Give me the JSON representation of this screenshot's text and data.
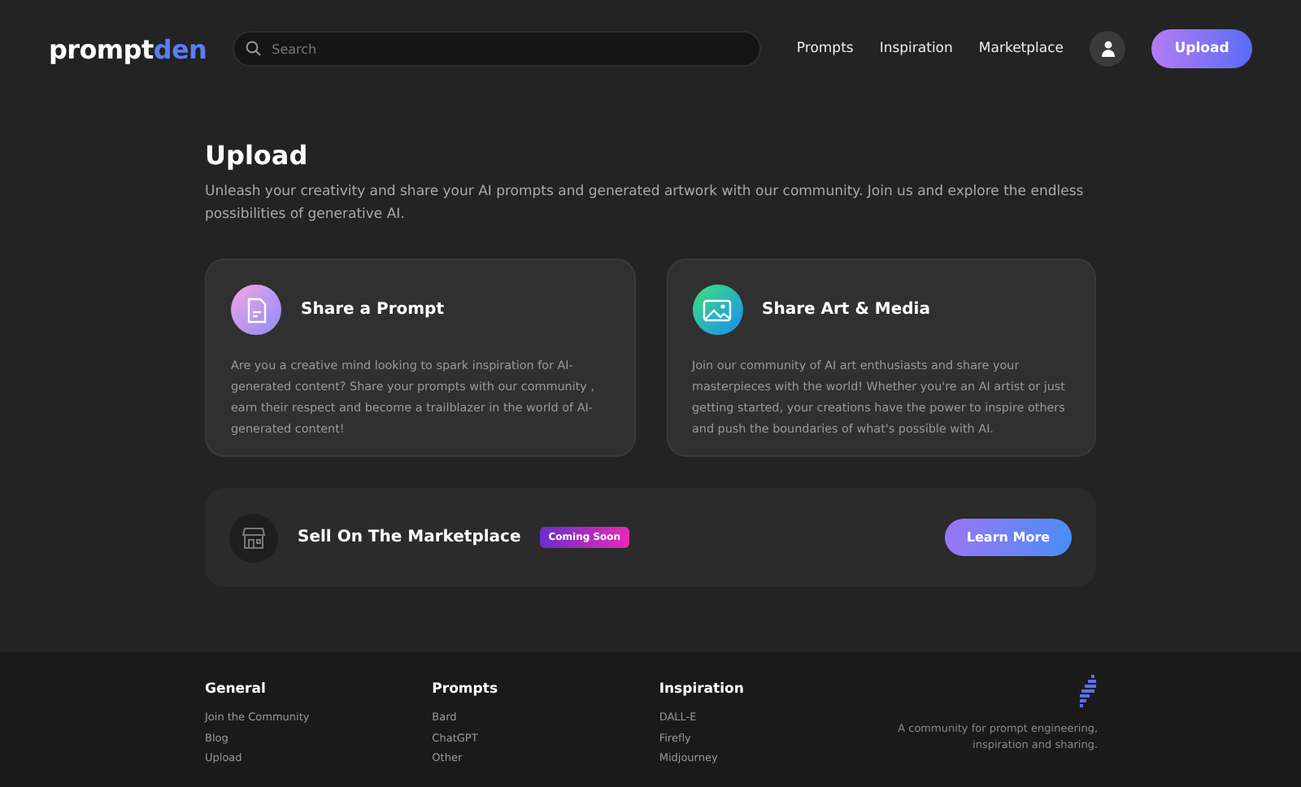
{
  "logo": {
    "first": "prompt",
    "second": "den"
  },
  "search": {
    "placeholder": "Search"
  },
  "nav": [
    "Prompts",
    "Inspiration",
    "Marketplace"
  ],
  "upload_button": "Upload",
  "page": {
    "title": "Upload",
    "intro": "Unleash your creativity and share your AI prompts and generated artwork with our community. Join us and explore the endless possibilities of generative AI."
  },
  "cards": [
    {
      "kind": "prompt",
      "title": "Share a Prompt",
      "text": "Are you a creative mind looking to spark inspiration for AI-generated content? Share your prompts with our community , earn their respect and become a trailblazer in the world of AI-generated content!"
    },
    {
      "kind": "media",
      "title": "Share Art & Media",
      "text": "Join our community of AI art enthusiasts and share your masterpieces with the world! Whether you're an AI artist or just getting started, your creations have the power to inspire others and push the boundaries of what's possible with AI."
    }
  ],
  "marketplace": {
    "title": "Sell On The Marketplace",
    "badge": "Coming Soon",
    "button": "Learn More"
  },
  "footer": {
    "columns": [
      {
        "heading": "General",
        "links": [
          "Join the Community",
          "Blog",
          "Upload"
        ]
      },
      {
        "heading": "Prompts",
        "links": [
          "Bard",
          "ChatGPT",
          "Other"
        ]
      },
      {
        "heading": "Inspiration",
        "links": [
          "DALL-E",
          "Firefly",
          "Midjourney"
        ]
      }
    ],
    "tagline": "A community for prompt engineering, inspiration and sharing."
  }
}
